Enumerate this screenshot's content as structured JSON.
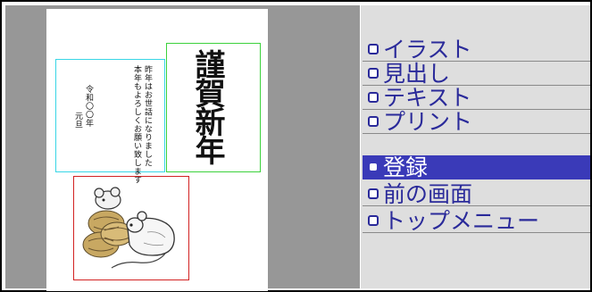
{
  "postcard": {
    "title_text": "謹賀新年",
    "message_lines": [
      "昨年はお世話になりました",
      "本年もよろしくお願い致します",
      "令和〇〇年",
      "元旦"
    ],
    "image_icon": "rat-on-rice-bales-illustration",
    "box_colors": {
      "message": "#38d6e6",
      "title": "#3cd23c",
      "image": "#d22222"
    }
  },
  "menu": {
    "items": [
      {
        "label": "イラスト",
        "selected": false
      },
      {
        "label": "見出し",
        "selected": false
      },
      {
        "label": "テキスト",
        "selected": false
      },
      {
        "label": "プリント",
        "selected": false
      },
      {
        "label": "登録",
        "selected": true
      },
      {
        "label": "前の画面",
        "selected": false
      },
      {
        "label": "トップメニュー",
        "selected": false
      }
    ],
    "colors": {
      "text": "#2a2a9a",
      "selected_background": "#3a3ab8",
      "selected_text": "#ffffff",
      "panel_background": "#dedede"
    }
  }
}
